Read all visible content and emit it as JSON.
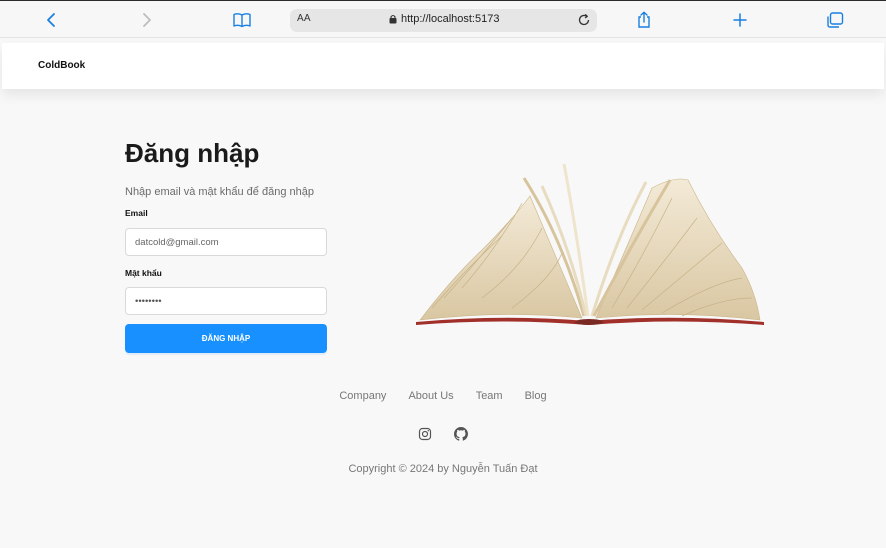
{
  "browser": {
    "reader_label": "AA",
    "url": "http://localhost:5173",
    "icons": [
      "back-icon",
      "forward-icon",
      "bookmarks-icon",
      "lock-icon",
      "reload-icon",
      "share-icon",
      "new-tab-icon",
      "tabs-icon"
    ],
    "accent": "#1a7fe0"
  },
  "header": {
    "logo": "ColdBook"
  },
  "login": {
    "title": "Đăng nhập",
    "subtitle": "Nhập email và mật khẩu để đăng nhập",
    "email_label": "Email",
    "email_placeholder": "datcold@gmail.com",
    "password_label": "Mật khẩu",
    "password_value": "••••••••",
    "submit_label": "ĐĂNG NHẬP",
    "button_color": "#1890ff"
  },
  "footer": {
    "links": [
      "Company",
      "About Us",
      "Team",
      "Blog"
    ],
    "social_icons": [
      "instagram-icon",
      "github-icon"
    ],
    "copyright": "Copyright © 2024 by Nguyễn Tuấn Đạt"
  }
}
